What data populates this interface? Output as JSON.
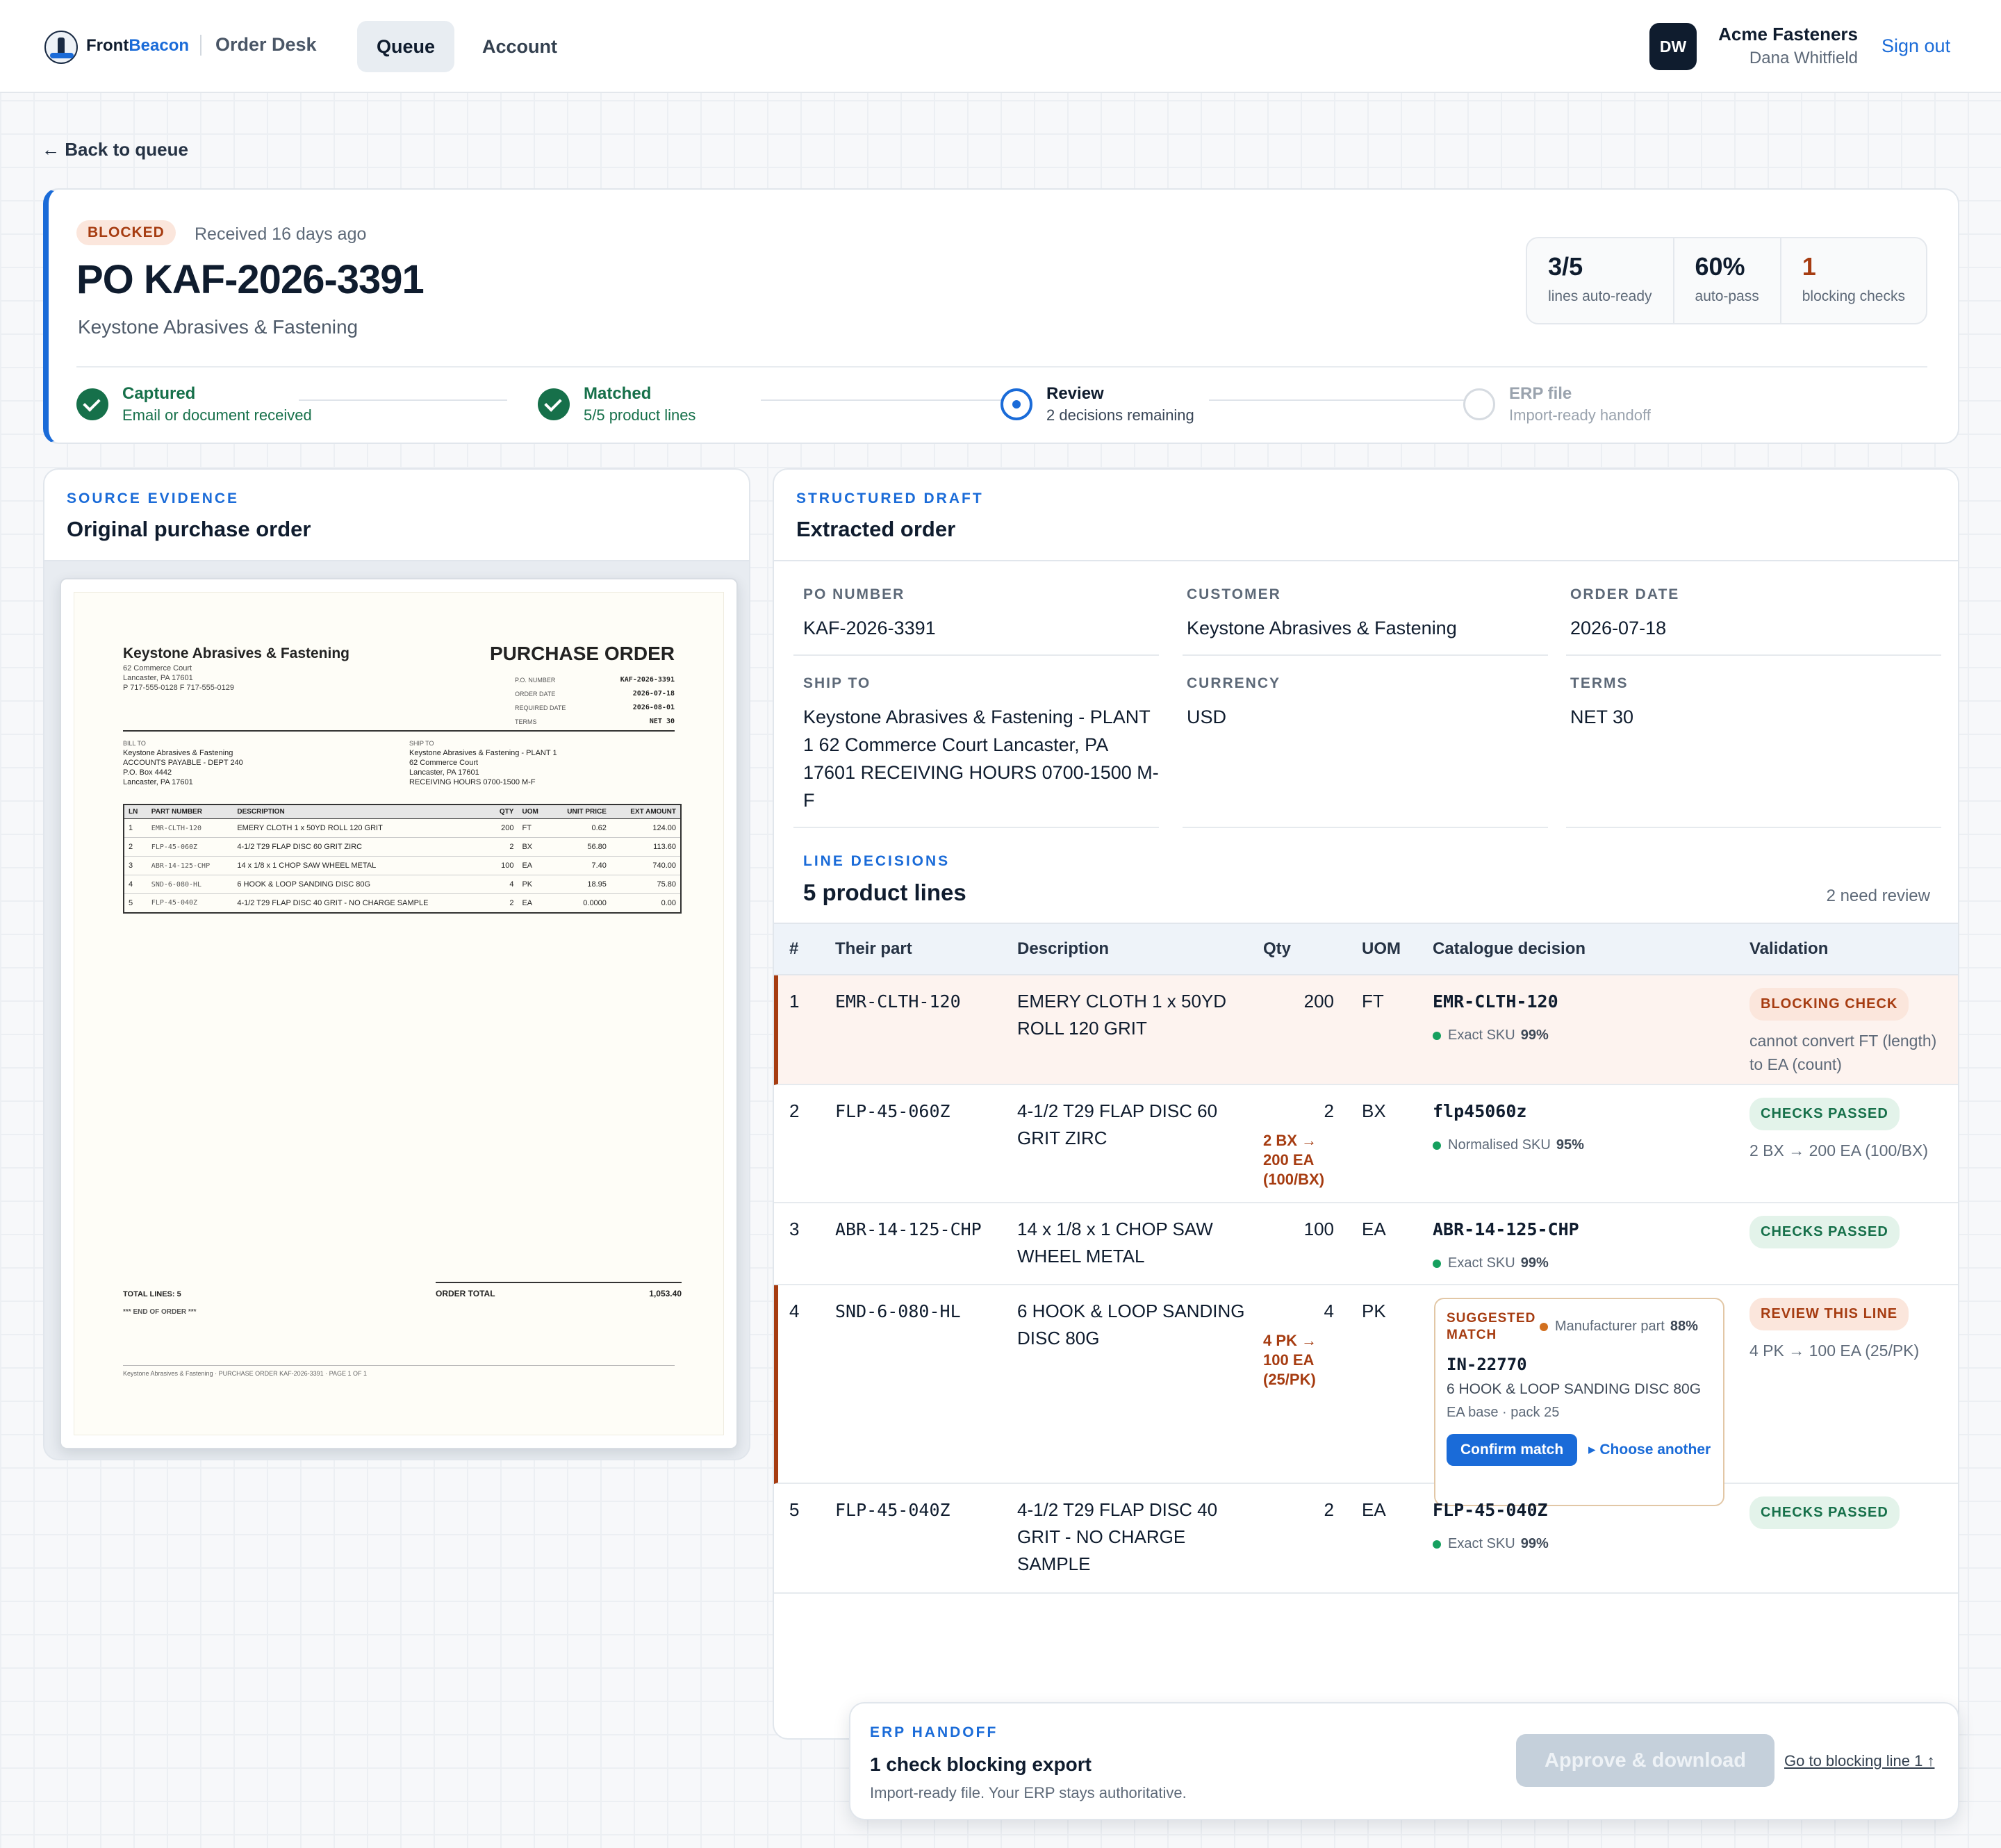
{
  "header": {
    "brand_a": "Front",
    "brand_b": "Beacon",
    "app_name": "Order Desk",
    "tabs": [
      "Queue",
      "Account"
    ],
    "avatar_initials": "DW",
    "org": "Acme Fasteners",
    "user": "Dana Whitfield",
    "sign_out": "Sign out"
  },
  "back_link": "← Back to queue",
  "summary": {
    "status": "BLOCKED",
    "received": "Received 16 days ago",
    "po_title": "PO KAF-2026-3391",
    "vendor": "Keystone Abrasives & Fastening",
    "stats": [
      {
        "value": "3/5",
        "label": "lines auto-ready"
      },
      {
        "value": "60%",
        "label": "auto-pass"
      },
      {
        "value": "1",
        "label": "blocking checks"
      }
    ],
    "steps": [
      {
        "title": "Captured",
        "sub": "Email or document received",
        "state": "done"
      },
      {
        "title": "Matched",
        "sub": "5/5 product lines",
        "state": "done"
      },
      {
        "title": "Review",
        "sub": "2 decisions remaining",
        "state": "current"
      },
      {
        "title": "ERP file",
        "sub": "Import-ready handoff",
        "state": "todo"
      }
    ]
  },
  "source": {
    "eyebrow": "SOURCE EVIDENCE",
    "title": "Original purchase order",
    "doc": {
      "company": "Keystone Abrasives & Fastening",
      "address": [
        "62 Commerce Court",
        "Lancaster, PA 17601",
        "P 717-555-0128   F 717-555-0129"
      ],
      "title": "PURCHASE ORDER",
      "meta": [
        [
          "P.O. NUMBER",
          "KAF-2026-3391"
        ],
        [
          "ORDER DATE",
          "2026-07-18"
        ],
        [
          "REQUIRED DATE",
          "2026-08-01"
        ],
        [
          "TERMS",
          "NET 30"
        ]
      ],
      "bill_to_label": "BILL TO",
      "bill_to": [
        "Keystone Abrasives & Fastening",
        "ACCOUNTS PAYABLE - DEPT 240",
        "P.O. Box 4442",
        "Lancaster, PA 17601"
      ],
      "ship_to_label": "SHIP TO",
      "ship_to": [
        "Keystone Abrasives & Fastening - PLANT 1",
        "62 Commerce Court",
        "Lancaster, PA 17601",
        "RECEIVING HOURS 0700-1500 M-F"
      ],
      "columns": [
        "LN",
        "PART NUMBER",
        "DESCRIPTION",
        "QTY",
        "UOM",
        "UNIT PRICE",
        "EXT AMOUNT"
      ],
      "rows": [
        [
          "1",
          "EMR-CLTH-120",
          "EMERY CLOTH 1 x 50YD ROLL 120 GRIT",
          "200",
          "FT",
          "0.62",
          "124.00"
        ],
        [
          "2",
          "FLP-45-060Z",
          "4-1/2 T29 FLAP DISC 60 GRIT ZIRC",
          "2",
          "BX",
          "56.80",
          "113.60"
        ],
        [
          "3",
          "ABR-14-125-CHP",
          "14 x 1/8 x 1 CHOP SAW WHEEL METAL",
          "100",
          "EA",
          "7.40",
          "740.00"
        ],
        [
          "4",
          "SND-6-080-HL",
          "6 HOOK & LOOP SANDING DISC 80G",
          "4",
          "PK",
          "18.95",
          "75.80"
        ],
        [
          "5",
          "FLP-45-040Z",
          "4-1/2 T29 FLAP DISC 40 GRIT - NO CHARGE SAMPLE",
          "2",
          "EA",
          "0.0000",
          "0.00"
        ]
      ],
      "total_lines": "TOTAL LINES: 5",
      "end": "*** END OF ORDER ***",
      "order_total_label": "ORDER TOTAL",
      "order_total": "1,053.40",
      "footer": "Keystone Abrasives & Fastening  ·  PURCHASE ORDER KAF-2026-3391  ·  PAGE 1 OF 1"
    }
  },
  "draft": {
    "eyebrow": "STRUCTURED DRAFT",
    "title": "Extracted order",
    "fields": {
      "po_number": {
        "label": "PO NUMBER",
        "value": "KAF-2026-3391"
      },
      "customer": {
        "label": "CUSTOMER",
        "value": "Keystone Abrasives & Fastening"
      },
      "order_date": {
        "label": "ORDER DATE",
        "value": "2026-07-18"
      },
      "ship_to": {
        "label": "SHIP TO",
        "value": "Keystone Abrasives & Fastening - PLANT 1 62 Commerce Court Lancaster, PA 17601 RECEIVING HOURS 0700-1500 M-F"
      },
      "currency": {
        "label": "CURRENCY",
        "value": "USD"
      },
      "terms": {
        "label": "TERMS",
        "value": "NET 30"
      }
    },
    "lines_eyebrow": "LINE DECISIONS",
    "lines_title": "5 product lines",
    "need_review": "2 need review",
    "columns": [
      "#",
      "Their part",
      "Description",
      "Qty",
      "UOM",
      "Catalogue decision",
      "Validation"
    ],
    "lines": [
      {
        "n": "1",
        "part": "EMR-CLTH-120",
        "desc": "EMERY CLOTH 1 x 50YD ROLL 120 GRIT",
        "qty": "200",
        "conv": "",
        "uom": "FT",
        "sku": "EMR-CLTH-120",
        "match": "Exact SKU",
        "conf": "99%",
        "status": "BLOCKING CHECK",
        "note": "cannot convert FT (length) to EA (count)"
      },
      {
        "n": "2",
        "part": "FLP-45-060Z",
        "desc": "4-1/2 T29 FLAP DISC 60 GRIT ZIRC",
        "qty": "2",
        "conv": "2 BX → 200 EA (100/BX)",
        "uom": "BX",
        "sku": "flp45060z",
        "match": "Normalised SKU",
        "conf": "95%",
        "status": "CHECKS PASSED",
        "note": "2 BX → 200 EA (100/BX)"
      },
      {
        "n": "3",
        "part": "ABR-14-125-CHP",
        "desc": "14 x 1/8 x 1 CHOP SAW WHEEL METAL",
        "qty": "100",
        "conv": "",
        "uom": "EA",
        "sku": "ABR-14-125-CHP",
        "match": "Exact SKU",
        "conf": "99%",
        "status": "CHECKS PASSED",
        "note": ""
      },
      {
        "n": "4",
        "part": "SND-6-080-HL",
        "desc": "6 HOOK & LOOP SANDING DISC 80G",
        "qty": "4",
        "conv": "4 PK → 100 EA (25/PK)",
        "uom": "PK",
        "status": "REVIEW THIS LINE",
        "note": "4 PK → 100 EA (25/PK)",
        "suggestion": {
          "label": "SUGGESTED MATCH",
          "match": "Manufacturer part",
          "conf": "88%",
          "sku": "IN-22770",
          "desc": "6 HOOK & LOOP SANDING DISC 80G",
          "base": "EA base · pack 25",
          "confirm": "Confirm match",
          "choose": "▸ Choose another"
        }
      },
      {
        "n": "5",
        "part": "FLP-45-040Z",
        "desc": "4-1/2 T29 FLAP DISC 40 GRIT - NO CHARGE SAMPLE",
        "qty": "2",
        "conv": "",
        "uom": "EA",
        "sku": "FLP-45-040Z",
        "match": "Exact SKU",
        "conf": "99%",
        "status": "CHECKS PASSED",
        "note": ""
      }
    ]
  },
  "erp": {
    "eyebrow": "ERP HANDOFF",
    "title": "1 check blocking export",
    "sub": "Import-ready file. Your ERP stays authoritative.",
    "approve": "Approve & download",
    "goto": "Go to blocking line 1 ↑"
  },
  "colors": {
    "accent": "#1a6bd8",
    "danger": "#a63c11",
    "success": "#16704a",
    "ink": "#0f1c2e"
  }
}
